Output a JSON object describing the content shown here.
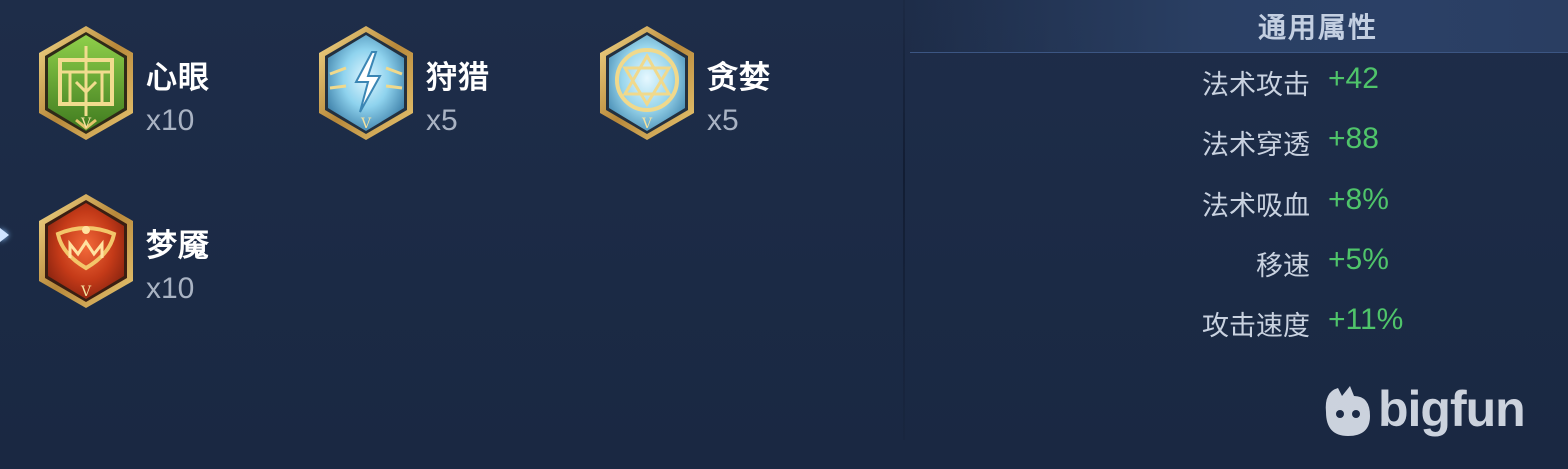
{
  "inscriptions": [
    {
      "name": "心眼",
      "count": "x10",
      "icon": "xinyan-green-icon",
      "color": "#5a9a2a"
    },
    {
      "name": "狩猎",
      "count": "x5",
      "icon": "shoulie-lightning-icon",
      "color": "#6fb8d8"
    },
    {
      "name": "贪婪",
      "count": "x5",
      "icon": "tanlan-star-icon",
      "color": "#7fc6e0"
    },
    {
      "name": "梦魇",
      "count": "x10",
      "icon": "mengyan-red-icon",
      "color": "#c8421c"
    }
  ],
  "attributes": {
    "title": "通用属性",
    "rows": [
      {
        "label": "法术攻击",
        "value": "+42"
      },
      {
        "label": "法术穿透",
        "value": "+88"
      },
      {
        "label": "法术吸血",
        "value": "+8%"
      },
      {
        "label": "移速",
        "value": "+5%"
      },
      {
        "label": "攻击速度",
        "value": "+11%"
      }
    ]
  },
  "watermark": {
    "text": "bigfun"
  },
  "colors": {
    "background": "#1c2a45",
    "positive_value": "#4fc46a",
    "gold_frame": "#c9a14a"
  }
}
